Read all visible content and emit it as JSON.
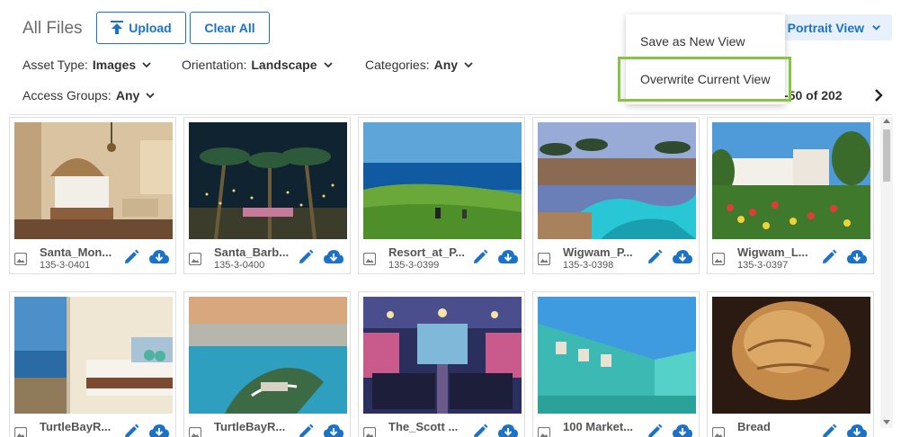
{
  "header": {
    "title": "All Files",
    "upload_label": "Upload",
    "clear_label": "Clear All"
  },
  "filters": [
    {
      "label": "Asset Type:",
      "value": "Images"
    },
    {
      "label": "Orientation:",
      "value": "Landscape"
    },
    {
      "label": "Categories:",
      "value": "Any"
    },
    {
      "label": "Access Groups:",
      "value": "Any"
    }
  ],
  "view": {
    "label": "Portrait View",
    "menu": [
      "Save as New View",
      "Overwrite Current View"
    ]
  },
  "pagination": {
    "text": "-50 of 202"
  },
  "colors": {
    "accent": "#1a73c8",
    "highlight": "#86c442"
  },
  "assets": [
    {
      "name": "Santa_Mon...",
      "code": "135-3-0401",
      "scene": "hotel-room-warm"
    },
    {
      "name": "Santa_Barb...",
      "code": "135-3-0400",
      "scene": "palm-night-lights"
    },
    {
      "name": "Resort_at_P...",
      "code": "135-3-0399",
      "scene": "golf-ocean-cliff"
    },
    {
      "name": "Wigwam_P...",
      "code": "135-3-0398",
      "scene": "resort-pool-dusk"
    },
    {
      "name": "Wigwam_L...",
      "code": "135-3-0397",
      "scene": "garden-flowers-villa"
    },
    {
      "name": "TurtleBayR...",
      "code": "",
      "scene": "hotel-room-ocean-view"
    },
    {
      "name": "TurtleBayR...",
      "code": "",
      "scene": "aerial-sunset-coast"
    },
    {
      "name": "The_Scott ...",
      "code": "",
      "scene": "ballroom-chairs"
    },
    {
      "name": "100 Market...",
      "code": "",
      "scene": "teal-building-sky"
    },
    {
      "name": "Bread",
      "code": "",
      "scene": "bread-loaf"
    }
  ]
}
